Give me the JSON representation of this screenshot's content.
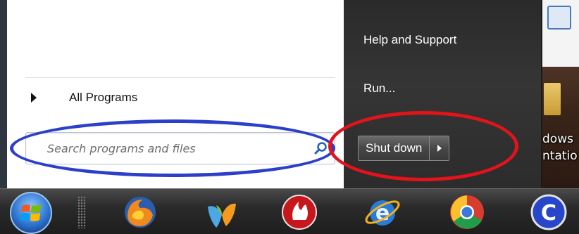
{
  "start_menu": {
    "all_programs_label": "All Programs",
    "search_placeholder": "Search programs and files",
    "right_items": [
      "Help and Support",
      "Run..."
    ],
    "shutdown_label": "Shut down"
  },
  "desktop": {
    "icon_text_lines": [
      "dows",
      "ntatio"
    ]
  },
  "taskbar": {
    "items": [
      "start-orb",
      "firefox-icon",
      "messenger-icon",
      "burner-icon",
      "internet-explorer-icon",
      "chrome-icon",
      "ccleaner-icon"
    ]
  },
  "colors": {
    "annotation_blue": "#2b3fc9",
    "annotation_red": "#e3131b",
    "right_pane": "#2f2f2f"
  }
}
